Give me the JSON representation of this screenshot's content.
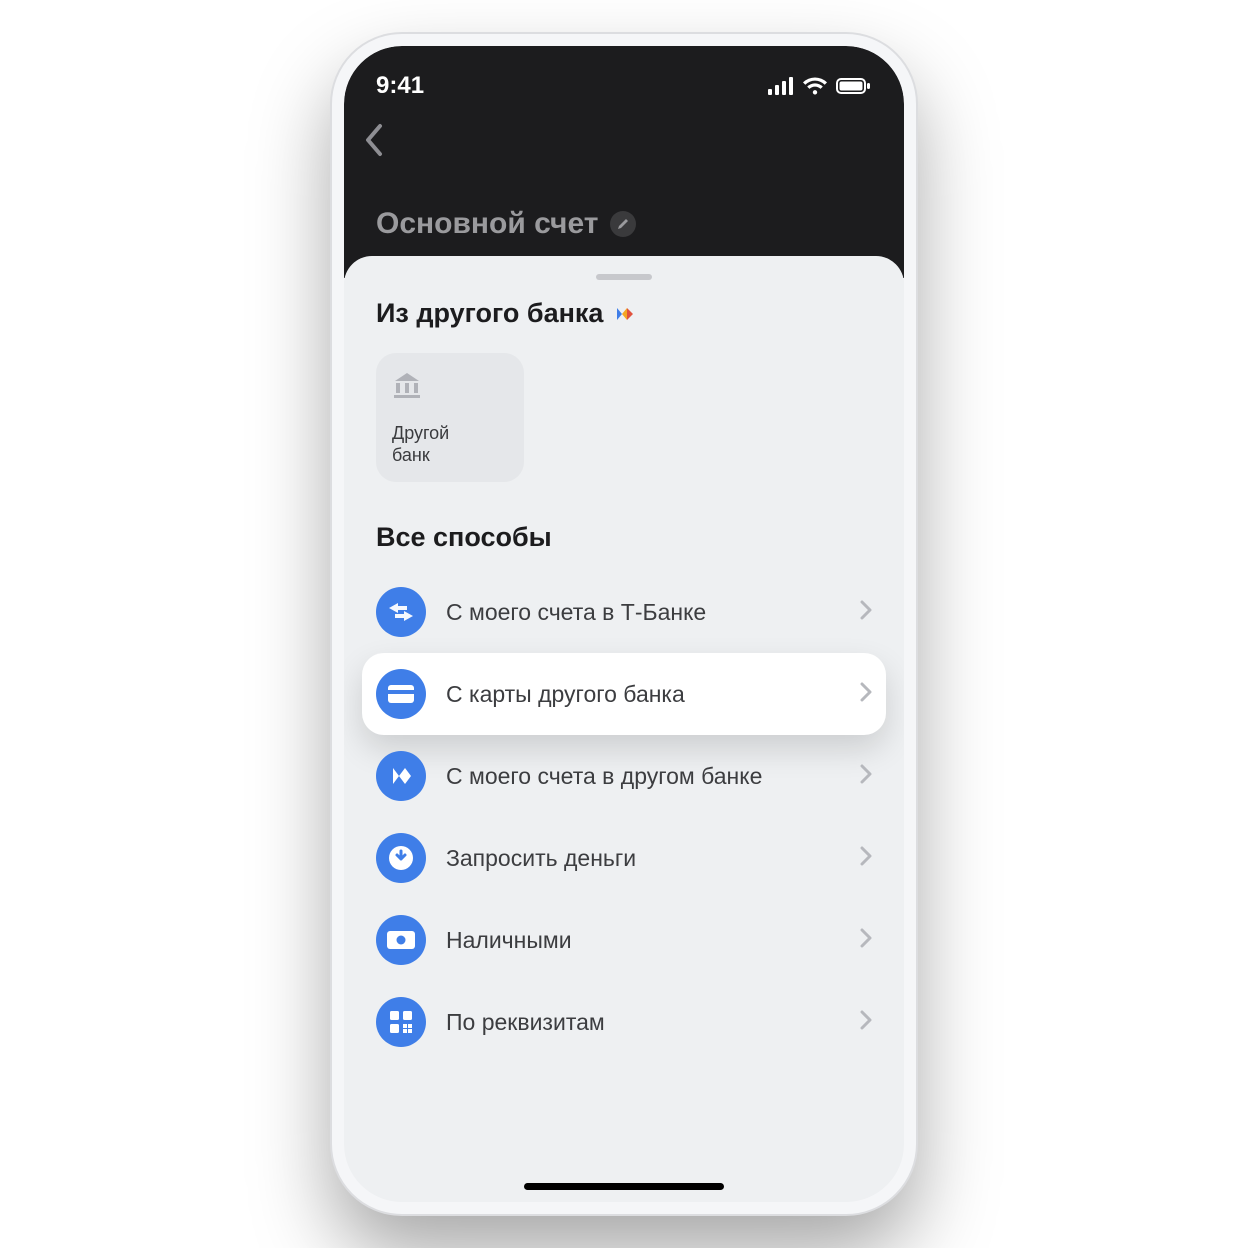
{
  "status": {
    "time": "9:41"
  },
  "header": {
    "account_title": "Основной счет"
  },
  "sheet": {
    "from_other_bank_title": "Из другого банка",
    "bank_tile": {
      "line1": "Другой",
      "line2": "банк"
    },
    "all_methods_title": "Все способы",
    "methods": [
      {
        "label": "С моего счета в Т‑Банке"
      },
      {
        "label": "С карты другого банка"
      },
      {
        "label": "С моего счета в другом банке"
      },
      {
        "label": "Запросить деньги"
      },
      {
        "label": "Наличными"
      },
      {
        "label": "По реквизитам"
      }
    ]
  }
}
